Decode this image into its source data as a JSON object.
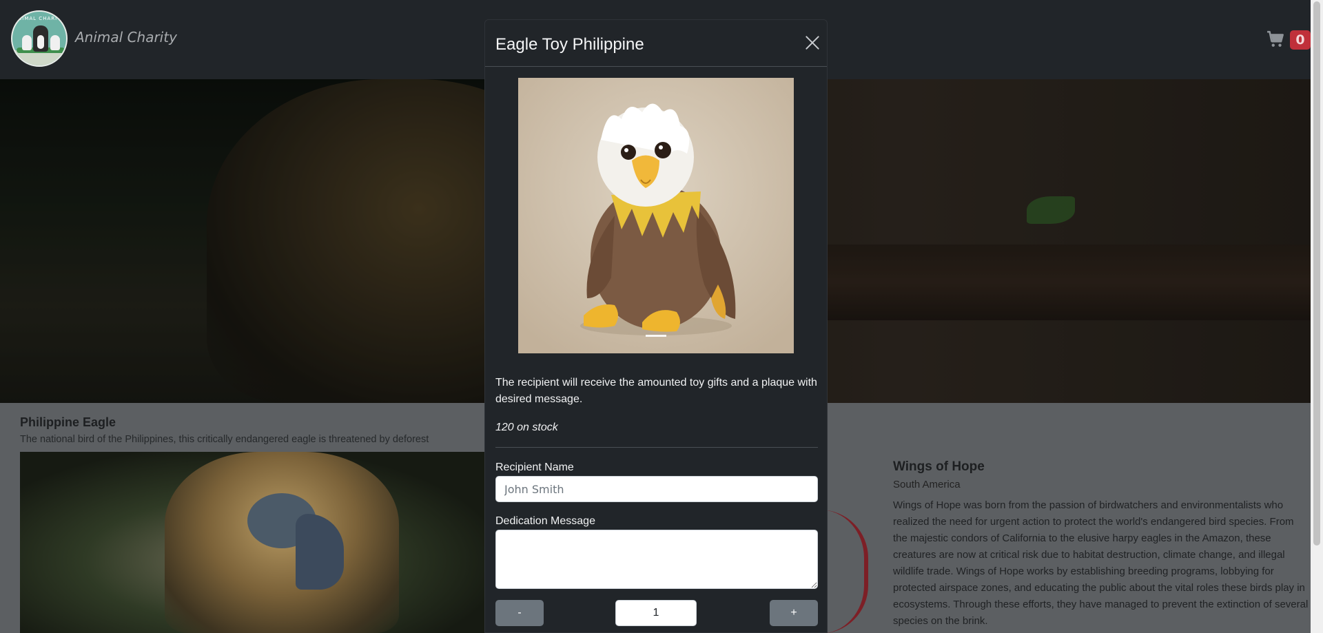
{
  "navbar": {
    "brand": "Animal Charity",
    "logo_text": "ANIMAL CHARITY",
    "cart_count": "0"
  },
  "content": {
    "eagle_title": "Philippine Eagle",
    "eagle_subtitle": "The national bird of the Philippines, this critically endangered eagle is threatened by deforest",
    "wings_title": "Wings of Hope",
    "wings_region": "South America",
    "wings_text": "Wings of Hope was born from the passion of birdwatchers and environmentalists who realized the need for urgent action to protect the world's endangered bird species. From the majestic condors of California to the elusive harpy eagles in the Amazon, these creatures are now at critical risk due to habitat destruction, climate change, and illegal wildlife trade. Wings of Hope works by establishing breeding programs, lobbying for protected airspace zones, and educating the public about the vital roles these birds play in ecosystems. Through these efforts, they have managed to prevent the extinction of several species on the brink."
  },
  "modal": {
    "title": "Eagle Toy Philippine",
    "description": "The recipient will receive the amounted toy gifts and a plaque with desired message.",
    "stock": "120 on stock",
    "recipient_label": "Recipient Name",
    "recipient_placeholder": "John Smith",
    "dedication_label": "Dedication Message",
    "dedication_value": "",
    "minus_label": "-",
    "plus_label": "+",
    "quantity": "1"
  },
  "colors": {
    "navbar_bg": "#212529",
    "modal_bg": "#212529",
    "badge_bg": "#c0303a",
    "button_bg": "#6c757d"
  },
  "icons": {
    "cart": "cart-icon",
    "close": "close-icon"
  }
}
